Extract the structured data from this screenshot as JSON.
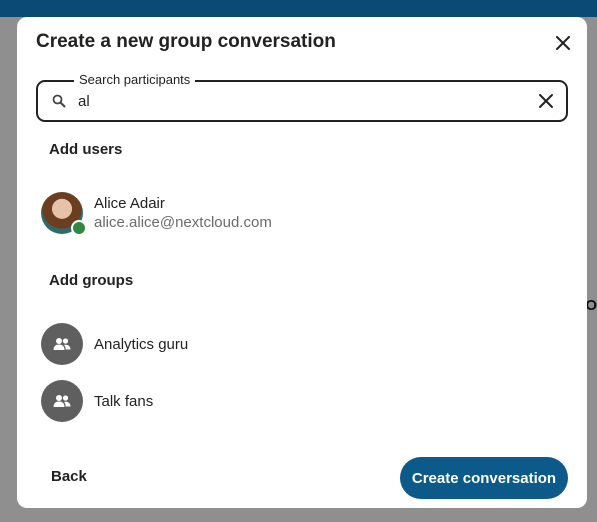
{
  "dialog": {
    "title": "Create a new group conversation"
  },
  "search": {
    "legend": "Search participants",
    "value": "al"
  },
  "sections": {
    "users_title": "Add users",
    "groups_title": "Add groups"
  },
  "users": [
    {
      "name": "Alice Adair",
      "email": "alice.alice@nextcloud.com",
      "status": "online"
    }
  ],
  "groups": [
    {
      "name": "Analytics guru"
    },
    {
      "name": "Talk fans"
    }
  ],
  "footer": {
    "back_label": "Back",
    "create_label": "Create conversation"
  },
  "colors": {
    "primary": "#0b5a8a",
    "online": "#2d8a3e",
    "group_avatar": "#5f5f5f"
  }
}
